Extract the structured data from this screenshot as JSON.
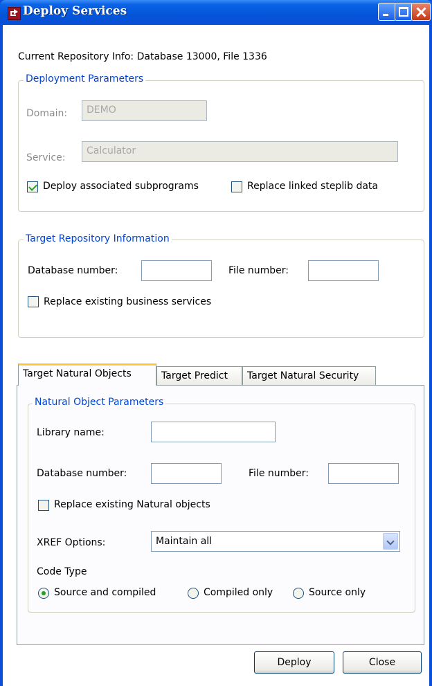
{
  "window": {
    "title": "Deploy Services",
    "repo_info": "Current Repository Info: Database 13000, File 1336"
  },
  "deployment": {
    "legend": "Deployment Parameters",
    "domain_label": "Domain:",
    "domain_value": "DEMO",
    "service_label": "Service:",
    "service_value": "Calculator",
    "deploy_sub_label": "Deploy associated subprograms",
    "deploy_sub_checked": true,
    "replace_steplib_label": "Replace linked steplib data",
    "replace_steplib_checked": false
  },
  "target_repo": {
    "legend": "Target Repository Information",
    "db_label": "Database number:",
    "db_value": "",
    "file_label": "File number:",
    "file_value": "",
    "replace_services_label": "Replace existing business services",
    "replace_services_checked": false
  },
  "tabs": [
    {
      "label": "Target Natural Objects",
      "active": true
    },
    {
      "label": "Target Predict",
      "active": false
    },
    {
      "label": "Target Natural Security",
      "active": false
    }
  ],
  "natural": {
    "legend": "Natural Object Parameters",
    "library_label": "Library name:",
    "library_value": "",
    "db_label": "Database number:",
    "db_value": "",
    "file_label": "File number:",
    "file_value": "",
    "replace_objects_label": "Replace existing Natural objects",
    "replace_objects_checked": false,
    "xref_label": "XREF Options:",
    "xref_value": "Maintain all",
    "code_type_label": "Code Type",
    "code_type_options": [
      "Source and compiled",
      "Compiled only",
      "Source only"
    ],
    "code_type_selected": "Source and compiled"
  },
  "buttons": {
    "deploy": "Deploy",
    "close": "Close"
  }
}
